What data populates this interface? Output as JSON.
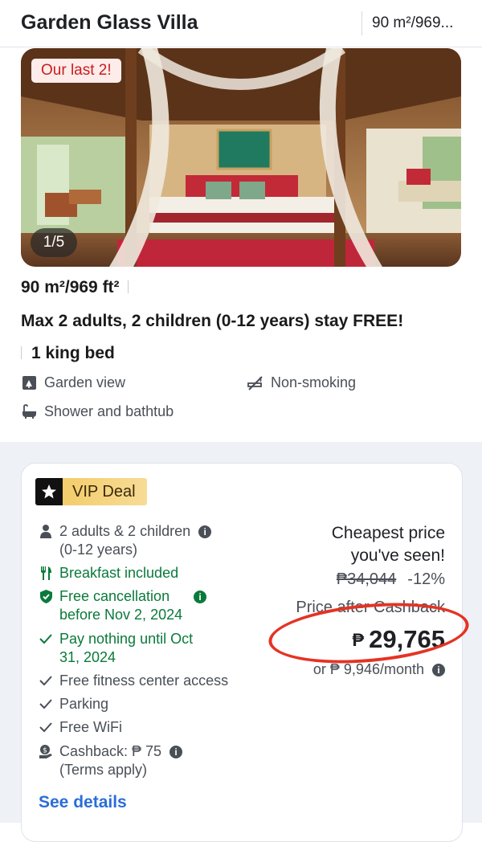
{
  "header": {
    "title": "Garden Glass Villa",
    "size_short": "90 m²/969..."
  },
  "photo": {
    "badge": "Our last 2!",
    "counter": "1/5"
  },
  "room": {
    "size": "90 m²/969 ft²",
    "occupancy": "Max 2 adults, 2 children (0-12 years) stay FREE!",
    "bed": "1 king bed",
    "amenities": {
      "view": "Garden view",
      "smoking": "Non-smoking",
      "bath": "Shower and bathtub"
    }
  },
  "deal": {
    "badge": "VIP Deal",
    "features": {
      "guests": [
        "2 adults & 2 children",
        "(0-12 years)"
      ],
      "breakfast": "Breakfast included",
      "cancellation": [
        "Free cancellation",
        "before Nov 2, 2024"
      ],
      "pay": [
        "Pay nothing until Oct",
        "31, 2024"
      ],
      "fitness": "Free fitness center access",
      "parking": "Parking",
      "wifi": "Free WiFi",
      "cashback": [
        "Cashback: ₱ 75",
        "(Terms apply)"
      ]
    },
    "pricing": {
      "cheapest": [
        "Cheapest price",
        "you've seen!"
      ],
      "original": "₱34,044",
      "discount": "-12%",
      "after_label": "Price after Cashback",
      "currency": "₱",
      "final": "29,765",
      "monthly": "or ₱ 9,946/month"
    },
    "see_details": "See details"
  },
  "colors": {
    "link": "#2a6ed8",
    "green": "#0a7a3a",
    "annotation_circle": "#e53324",
    "badge_red": "#c81e1e"
  }
}
